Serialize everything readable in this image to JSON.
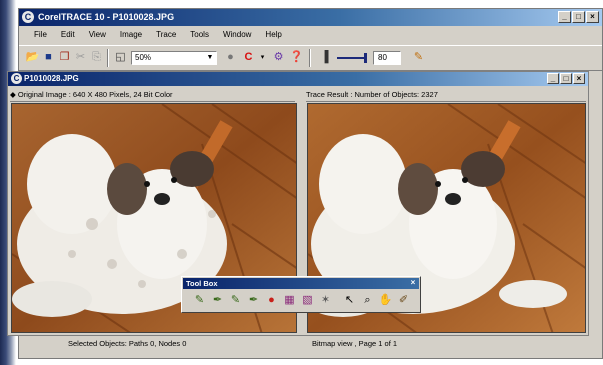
{
  "app": {
    "title": "CorelTRACE 10 - P1010028.JPG"
  },
  "window_buttons": {
    "minimize": "_",
    "maximize": "□",
    "close": "×"
  },
  "menu": [
    "File",
    "Edit",
    "View",
    "Image",
    "Trace",
    "Tools",
    "Window",
    "Help"
  ],
  "toolbar": {
    "zoom_value": "50%",
    "number_value": "80"
  },
  "document": {
    "title": "P1010028.JPG",
    "original_header": "Original Image : 640 X 480 Pixels, 24 Bit Color",
    "trace_header": "Trace Result : Number of Objects: 2327"
  },
  "toolbox": {
    "title": "Tool Box"
  },
  "status": {
    "selected": "Selected Objects: Paths 0, Nodes 0",
    "view": "Bitmap view , Page 1 of 1"
  },
  "colors": {
    "title_active": "#0a246a",
    "chrome": "#d4d0c8"
  }
}
